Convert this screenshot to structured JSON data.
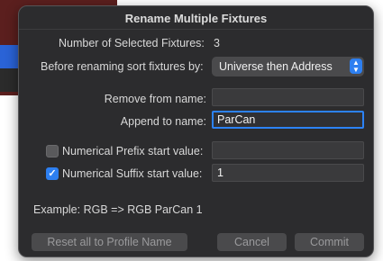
{
  "dialog": {
    "title": "Rename Multiple Fixtures",
    "selected_label": "Number of Selected Fixtures:",
    "selected_count": "3",
    "sort_label": "Before renaming sort fixtures by:",
    "sort_value": "Universe then Address",
    "remove_label": "Remove from name:",
    "remove_value": "",
    "append_label": "Append to name:",
    "append_value": "ParCan",
    "prefix_label": "Numerical Prefix start value:",
    "prefix_checked": false,
    "prefix_value": "",
    "suffix_label": "Numerical Suffix start value:",
    "suffix_checked": true,
    "suffix_value": "1",
    "example_text": "Example:  RGB => RGB ParCan 1"
  },
  "buttons": {
    "reset": "Reset all to Profile Name",
    "cancel": "Cancel",
    "commit": "Commit"
  },
  "colors": {
    "accent": "#2d7ff0",
    "panel": "#2c2c2e"
  }
}
